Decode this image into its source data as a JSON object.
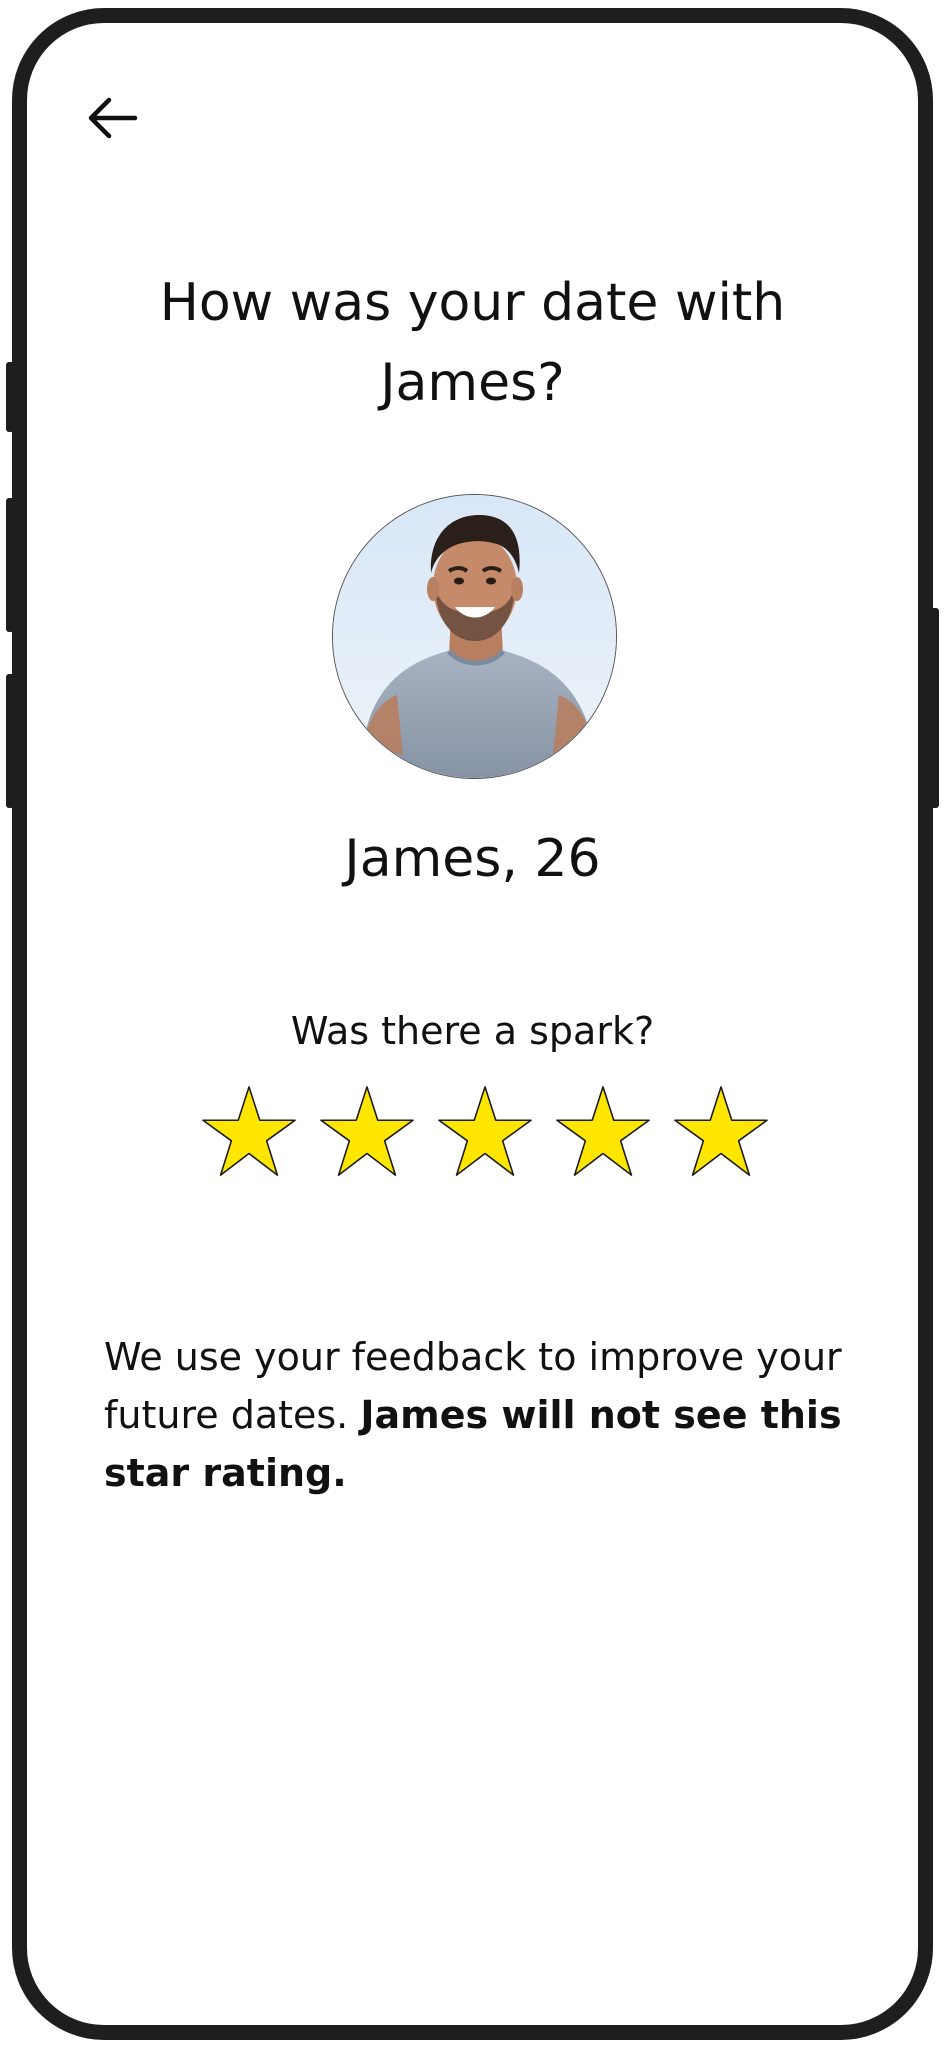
{
  "header": {
    "back_icon": "arrow-left-icon"
  },
  "title": {
    "line1": "How was your date with",
    "line2": "James?"
  },
  "profile": {
    "photo": "profile-photo",
    "name_age": "James, 26"
  },
  "rating": {
    "question": "Was there a spark?",
    "stars_filled": 5,
    "stars_total": 5,
    "star_color": "#FFE600",
    "star_outline": "#1a1a1a"
  },
  "feedback": {
    "normal_text": "We use your feedback to improve your future dates. ",
    "bold_text": "James will not see this star rating."
  },
  "colors": {
    "frame": "#1e1e1e",
    "text": "#111111",
    "background": "#ffffff"
  }
}
